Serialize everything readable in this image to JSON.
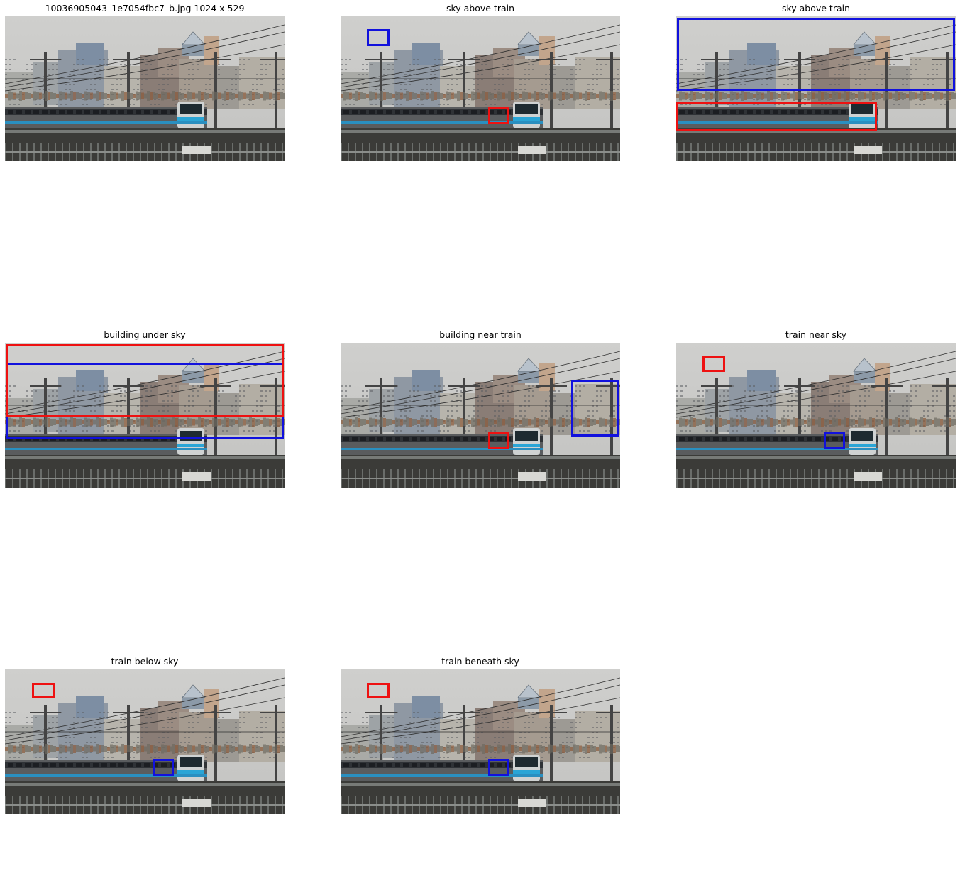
{
  "figure": {
    "panels": [
      {
        "title": "10036905043_1e7054fbc7_b.jpg 1024 x 529",
        "subject_box_color": "",
        "object_box_color": ""
      },
      {
        "title": "sky above train",
        "subject_box_color": "#1111dd",
        "object_box_color": "#ee1111"
      },
      {
        "title": "sky above train",
        "subject_box_color": "#1111dd",
        "object_box_color": "#ee1111"
      },
      {
        "title": "building under sky",
        "subject_box_color": "#1111dd",
        "object_box_color": "#ee1111"
      },
      {
        "title": "building near train",
        "subject_box_color": "#1111dd",
        "object_box_color": "#ee1111"
      },
      {
        "title": "train near sky",
        "subject_box_color": "#1111dd",
        "object_box_color": "#ee1111"
      },
      {
        "title": "train below sky",
        "subject_box_color": "#1111dd",
        "object_box_color": "#ee1111"
      },
      {
        "title": "train beneath sky",
        "subject_box_color": "#1111dd",
        "object_box_color": "#ee1111"
      }
    ]
  }
}
